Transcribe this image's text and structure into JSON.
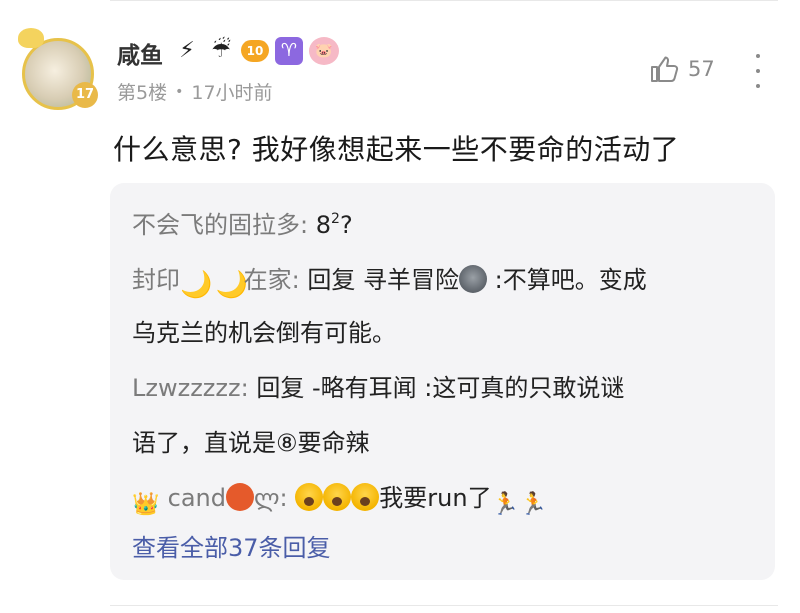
{
  "post": {
    "author": "咸鱼",
    "floor": "第5楼",
    "separator": "•",
    "time": "17小时前",
    "likes": "57",
    "content": "什么意思? 我好像想起来一些不要命的活动了",
    "badges": [
      "lightning-emoji",
      "umbrella-rain-emoji",
      "level-badge",
      "aries-badge",
      "pig-badge"
    ],
    "level_badge_text": "10",
    "avatar_badge_text": "17"
  },
  "replies": {
    "items": [
      {
        "author": "不会飞的固拉多",
        "colon": ":",
        "text": "8",
        "sup": "2",
        "text2": "?"
      },
      {
        "author": "封印",
        "author2": "在家",
        "colon": ":",
        "text": "回复 寻羊冒险",
        "text2": ":不算吧。变成",
        "line2": "乌克兰的机会倒有可能。"
      },
      {
        "author": "Lzwzzzzz",
        "colon": ":",
        "text": "回复 -略有耳闻 :这可真的只敢说谜",
        "line2": "语了，直说是⑧要命辣"
      },
      {
        "author": "cand",
        "author2": "ლ",
        "colon": ":",
        "text": "我要run了"
      }
    ],
    "view_all": "查看全部37条回复"
  },
  "colors": {
    "link": "#4a5da8",
    "author": "#7b7b7b",
    "meta": "#9a9a9a",
    "reply_bg": "#f4f4f6"
  }
}
